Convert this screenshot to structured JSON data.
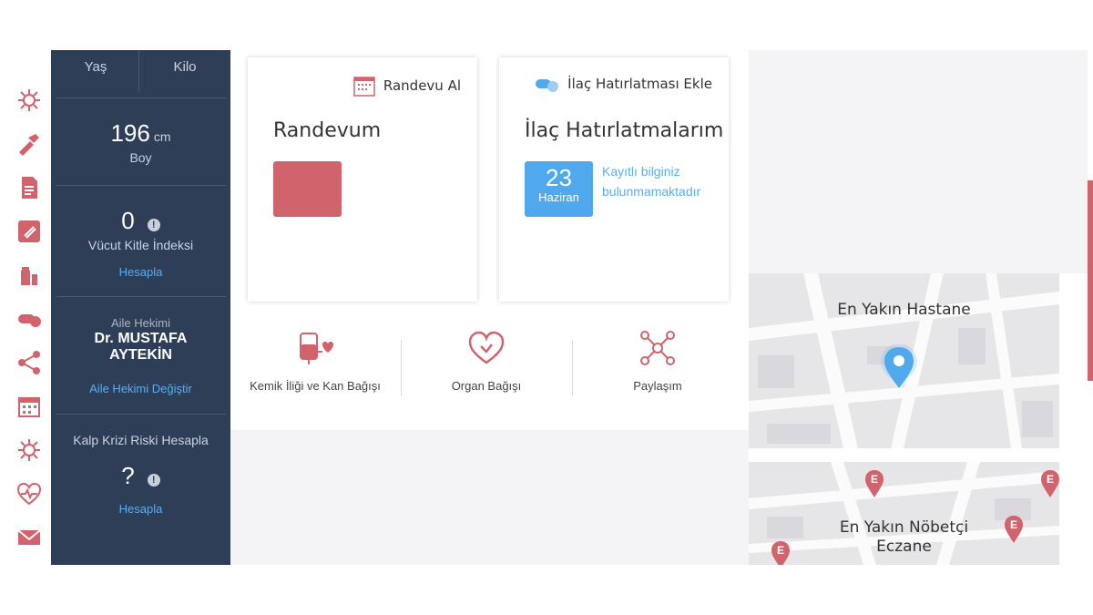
{
  "sidebar": {
    "top_cols": [
      "Yaş",
      "Kilo"
    ],
    "height": {
      "value": "196",
      "unit": "cm",
      "label": "Boy"
    },
    "bmi": {
      "value": "0",
      "label": "Vücut Kitle İndeksi",
      "link": "Hesapla",
      "info": "!"
    },
    "doctor": {
      "label": "Aile Hekimi",
      "name_line1": "Dr. MUSTAFA",
      "name_line2": "AYTEKİN",
      "link": "Aile Hekimi Değiştir"
    },
    "heart_risk": {
      "label": "Kalp Krizi Riski Hesapla",
      "value": "?",
      "link": "Hesapla",
      "info": "!"
    }
  },
  "rail_icons": [
    "virus-icon",
    "bandage-icon",
    "document-icon",
    "clip-icon",
    "medicine-bottle-icon",
    "pill-icon",
    "share-icon",
    "calendar-icon",
    "virus-icon",
    "heartbeat-icon",
    "mail-icon"
  ],
  "appointment_card": {
    "action": "Randevu Al",
    "title": "Randevum"
  },
  "medication_card": {
    "action": "İlaç Hatırlatması Ekle",
    "title": "İlaç Hatırlatmalarım",
    "date_day": "23",
    "date_month": "Haziran",
    "note_line1": "Kayıtlı bilginiz",
    "note_line2": "bulunmamaktadır"
  },
  "quick_links": [
    "Kemik İliği ve Kan Bağışı",
    "Organ Bağışı",
    "Paylaşım"
  ],
  "maps": {
    "hospital_title": "En Yakın Hastane",
    "pharmacy_line1": "En Yakın Nöbetçi",
    "pharmacy_line2": "Eczane",
    "pharmacy_pin_letter": "E"
  },
  "colors": {
    "accent_red": "#d0636c",
    "sidebar_bg": "#2e3e57",
    "link_blue": "#5aaef0",
    "date_blue": "#4fa9ec"
  }
}
